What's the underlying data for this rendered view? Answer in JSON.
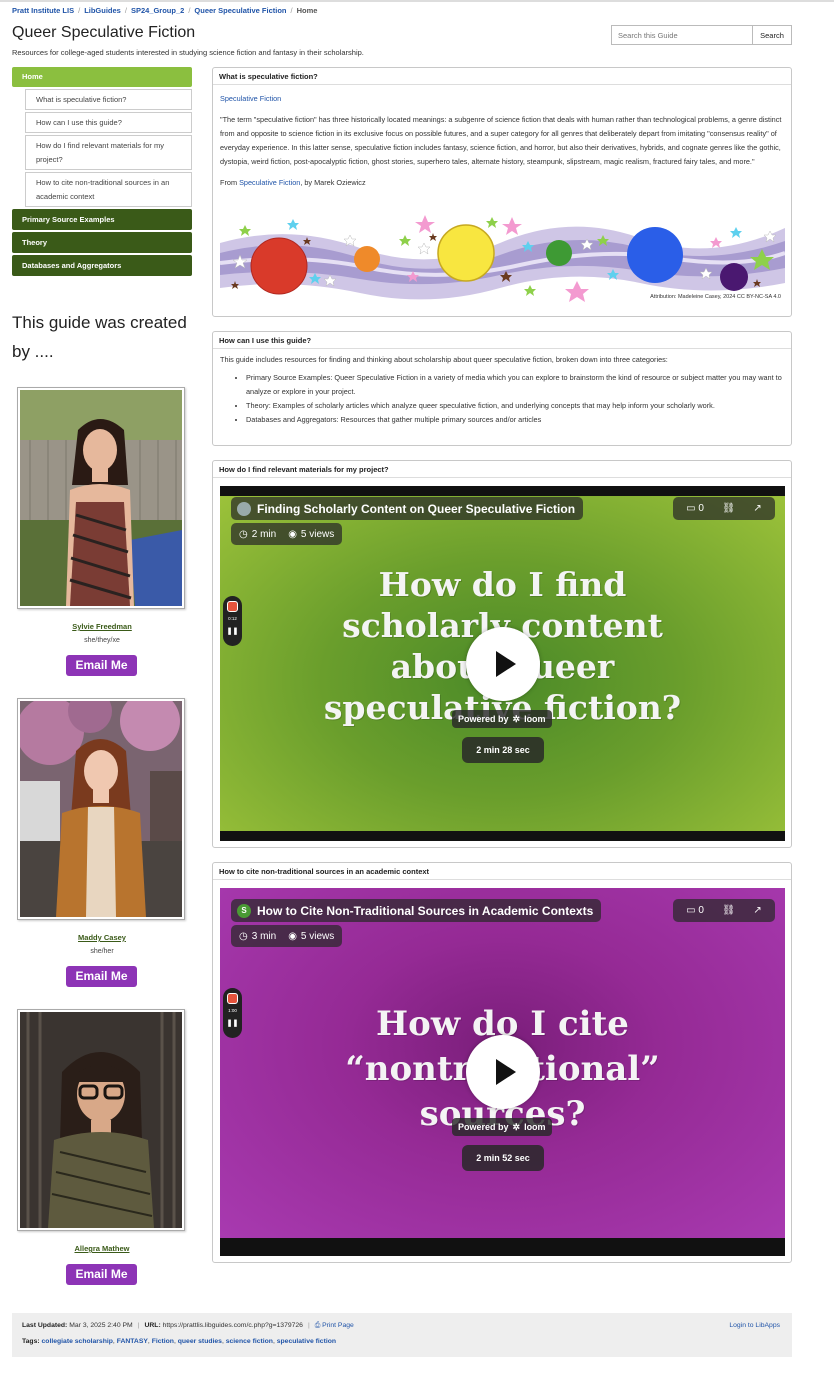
{
  "breadcrumb": [
    "Pratt Institute LIS",
    "LibGuides",
    "SP24_Group_2",
    "Queer Speculative Fiction",
    "Home"
  ],
  "header": {
    "title": "Queer Speculative Fiction",
    "description": "Resources for college-aged students interested in studying science fiction and fantasy in their scholarship.",
    "search_placeholder": "Search this Guide",
    "search_button": "Search"
  },
  "nav": {
    "home": "Home",
    "sub_items": [
      "What is speculative fiction?",
      "How can I use this guide?",
      "How do I find relevant materials for my project?",
      "How to cite non-traditional sources in an academic context"
    ],
    "sections": [
      "Primary Source Examples",
      "Theory",
      "Databases and Aggregators"
    ]
  },
  "sidebar": {
    "created_by": "This guide was created by ....",
    "email_label": "Email Me",
    "profiles": [
      {
        "name": "Sylvie Freedman",
        "pronouns": "she/they/xe"
      },
      {
        "name": "Maddy Casey",
        "pronouns": "she/her"
      },
      {
        "name": "Allegra Mathew",
        "pronouns": ""
      }
    ]
  },
  "box1": {
    "heading": "What is speculative fiction?",
    "link": "Speculative Fiction",
    "quote": "\"The term \"speculative fiction\" has three historically located meanings: a subgenre of science fiction that deals with human rather than technological problems, a genre distinct from and opposite to science fiction in its exclusive focus on possible futures, and a super category for all genres that deliberately depart from imitating \"consensus reality\" of everyday experience. In this latter sense, speculative fiction includes fantasy, science fiction, and horror, but also their derivatives, hybrids, and cognate genres like the gothic, dystopia, weird fiction, post-apocalyptic fiction, ghost stories, superhero tales, alternate history, steampunk, slipstream, magic realism, fractured fairy tales, and more.\"",
    "from_prefix": "From ",
    "from_link": "Speculative Fiction",
    "from_suffix": ", by Marek Oziewicz",
    "attribution": "Attribution: Madeleine Casey, 2024 CC BY-NC-SA 4.0"
  },
  "box2": {
    "heading": "How can I use this guide?",
    "intro": "This guide includes resources for finding and thinking about scholarship about queer speculative fiction, broken down into three categories:",
    "bullets": [
      "Primary Source Examples: Queer Speculative Fiction in a variety of media which you can explore to brainstorm the kind of resource or subject matter you may want to analyze or explore in your project.",
      "Theory: Examples of scholarly articles which analyze queer speculative fiction, and underlying concepts that may help inform your scholarly work.",
      "Databases and Aggregators: Resources that gather multiple primary sources and/or articles"
    ]
  },
  "box3": {
    "heading": "How do I find relevant materials for my project?",
    "video": {
      "title": "Finding Scholarly Content on Queer Speculative Fiction",
      "minutes": "2 min",
      "views": "5 views",
      "comments": "0",
      "headline": [
        "How do I find",
        "scholarly content",
        "about queer",
        "speculative fiction?"
      ],
      "powered": "Powered by",
      "brand": "loom",
      "duration": "2 min 28 sec",
      "rec_time": "0:12"
    }
  },
  "box4": {
    "heading": "How to cite non-traditional sources in an academic context",
    "video": {
      "title": "How to Cite Non-Traditional Sources in Academic Contexts",
      "avatar_letter": "S",
      "minutes": "3 min",
      "views": "5 views",
      "comments": "0",
      "headline": [
        "How do I cite",
        "“nontraditional”",
        "sources?"
      ],
      "powered": "Powered by",
      "brand": "loom",
      "duration": "2 min 52 sec",
      "rec_time": "1:00"
    }
  },
  "footer": {
    "updated_label": "Last Updated:",
    "updated_value": "Mar 3, 2025 2:40 PM",
    "url_label": "URL:",
    "url_value": "https://prattlis.libguides.com/c.php?g=1379726",
    "print": "Print Page",
    "login": "Login to LibApps",
    "tags_label": "Tags:",
    "tags": [
      "collegiate scholarship",
      "FANTASY",
      "Fiction",
      "queer studies",
      "science fiction",
      "speculative fiction"
    ]
  },
  "colors": {
    "nav_home": "#8bbf3f",
    "nav_section": "#3a5a18",
    "email_button": "#8d34b6",
    "link": "#2054a8"
  }
}
